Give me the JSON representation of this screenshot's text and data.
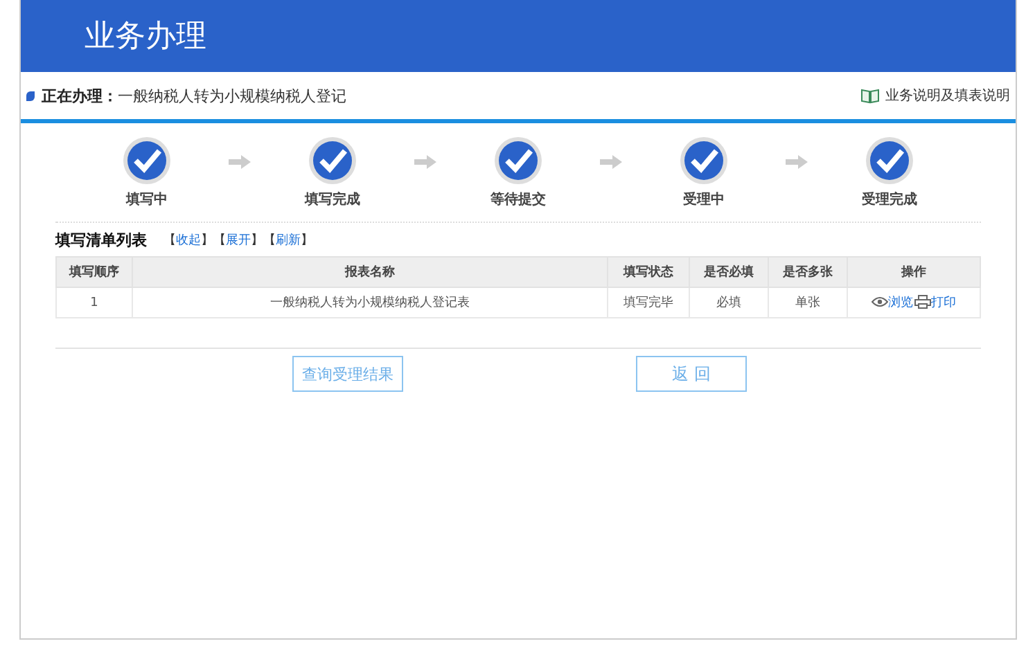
{
  "header": {
    "title": "业务办理"
  },
  "current": {
    "label": "正在办理：",
    "value": "一般纳税人转为小规模纳税人登记",
    "help_link": "业务说明及填表说明"
  },
  "steps": [
    {
      "label": "填写中",
      "done": true
    },
    {
      "label": "填写完成",
      "done": true
    },
    {
      "label": "等待提交",
      "done": true
    },
    {
      "label": "受理中",
      "done": true
    },
    {
      "label": "受理完成",
      "done": true
    }
  ],
  "list_title": "填写清单列表",
  "list_actions": [
    {
      "kind": "punct",
      "text": "【"
    },
    {
      "kind": "link",
      "text": "收起"
    },
    {
      "kind": "punct",
      "text": "】【"
    },
    {
      "kind": "link",
      "text": "展开"
    },
    {
      "kind": "punct",
      "text": "】【"
    },
    {
      "kind": "link",
      "text": "刷新"
    },
    {
      "kind": "punct",
      "text": "】"
    }
  ],
  "table": {
    "columns": [
      "填写顺序",
      "报表名称",
      "填写状态",
      "是否必填",
      "是否多张",
      "操作"
    ],
    "rows": [
      {
        "cells": [
          "1",
          "一般纳税人转为小规模纳税人登记表",
          "填写完毕",
          "必填",
          "单张"
        ],
        "actions": [
          {
            "kind": "view",
            "label": "浏览"
          },
          {
            "kind": "print",
            "label": "打印"
          }
        ]
      }
    ]
  },
  "buttons": [
    "查询受理结果",
    "返 回"
  ]
}
